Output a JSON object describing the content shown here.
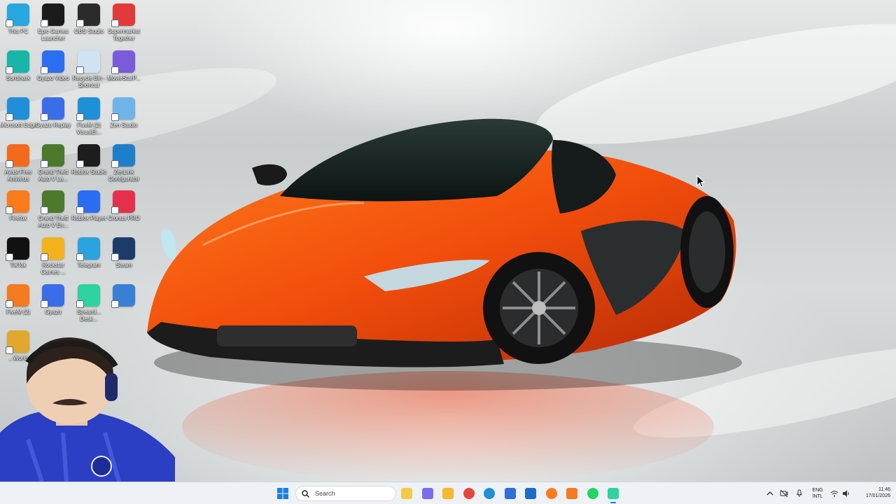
{
  "desktop": {
    "icons": [
      {
        "label": "This PC",
        "icon": "monitor-icon",
        "color": "#26a7e0"
      },
      {
        "label": "Epic Games Launcher",
        "icon": "epic-games-icon",
        "color": "#1b1b1b"
      },
      {
        "label": "OBS Studio",
        "icon": "obs-icon",
        "color": "#2b2b2b"
      },
      {
        "label": "Supermarket Together",
        "icon": "supermarket-icon",
        "color": "#e23a3a"
      },
      {
        "label": "Surfshark",
        "icon": "surfshark-icon",
        "color": "#17b6a9"
      },
      {
        "label": "Gyazo Video",
        "icon": "gyazo-video-icon",
        "color": "#2b6ef2"
      },
      {
        "label": "Recycle Bin - Shortcut",
        "icon": "recycle-bin-icon",
        "color": "#cfe3f3"
      },
      {
        "label": "MovieStarP...",
        "icon": "moviestar-icon",
        "color": "#7a5bd9"
      },
      {
        "label": "Microsoft Edge",
        "icon": "edge-icon",
        "color": "#1f8fd8"
      },
      {
        "label": "Gyazo Replay",
        "icon": "gyazo-replay-icon",
        "color": "#3b6de8"
      },
      {
        "label": "FiveM (2) VisualEl...",
        "icon": "edge-icon",
        "color": "#1f8fd8"
      },
      {
        "label": "Zen Studio",
        "icon": "zen-studio-icon",
        "color": "#6fb4e8"
      },
      {
        "label": "Avast Free Antivirus",
        "icon": "avast-icon",
        "color": "#f26b1d"
      },
      {
        "label": "Grand Theft Auto V La...",
        "icon": "gta-icon",
        "color": "#4c7a2a"
      },
      {
        "label": "Roblox Studio",
        "icon": "roblox-studio-icon",
        "color": "#1d1d1d"
      },
      {
        "label": "ZenLink Configurator",
        "icon": "zenlink-icon",
        "color": "#1e7fc9"
      },
      {
        "label": "Firefox",
        "icon": "firefox-icon",
        "color": "#ff7a1a"
      },
      {
        "label": "Grand Theft Auto V En...",
        "icon": "gta-icon",
        "color": "#4c7a2a"
      },
      {
        "label": "Roblox Player",
        "icon": "roblox-player-icon",
        "color": "#2a6df0"
      },
      {
        "label": "Cronus PRO",
        "icon": "cronus-icon",
        "color": "#e6304a"
      },
      {
        "label": "TikTok",
        "icon": "tiktok-icon",
        "color": "#111111"
      },
      {
        "label": "Rockstar Games ...",
        "icon": "rockstar-icon",
        "color": "#f3b21b"
      },
      {
        "label": "Telegram",
        "icon": "telegram-icon",
        "color": "#2aa3de"
      },
      {
        "label": "Steam",
        "icon": "steam-icon",
        "color": "#1b3b6a"
      },
      {
        "label": "FiveM (2)",
        "icon": "fivem-icon",
        "color": "#f47b20"
      },
      {
        "label": "Gyazo",
        "icon": "gyazo-icon",
        "color": "#3b6de8"
      },
      {
        "label": "Streaml... Desk...",
        "icon": "streamlabs-icon",
        "color": "#2fd2a1"
      },
      {
        "label": "",
        "icon": "fortnite-icon",
        "color": "#3a7fd6"
      },
      {
        "label": "...World",
        "icon": "world-icon",
        "color": "#e0a82c"
      }
    ]
  },
  "taskbar": {
    "search_placeholder": "Search",
    "apps": [
      {
        "name": "file-explorer-pinned-icon",
        "color": "#f2c94c"
      },
      {
        "name": "copilot-icon",
        "color": "#7a6cf0"
      },
      {
        "name": "file-explorer-icon",
        "color": "#f5b82e"
      },
      {
        "name": "chrome-icon",
        "color": "#e8453c"
      },
      {
        "name": "edge-icon",
        "color": "#1f8fd8"
      },
      {
        "name": "microsoft-store-icon",
        "color": "#2f6fd6"
      },
      {
        "name": "outlook-icon",
        "color": "#1c6cc4"
      },
      {
        "name": "firefox-icon",
        "color": "#ff7a1a"
      },
      {
        "name": "fivem-icon",
        "color": "#f47b20"
      },
      {
        "name": "spotify-icon",
        "color": "#1ed760"
      },
      {
        "name": "streamlabs-icon",
        "color": "#2fd2a1"
      }
    ],
    "tray": {
      "language_line1": "ENG",
      "language_line2": "INTL",
      "time": "11:46",
      "date": "17/01/2026"
    }
  }
}
